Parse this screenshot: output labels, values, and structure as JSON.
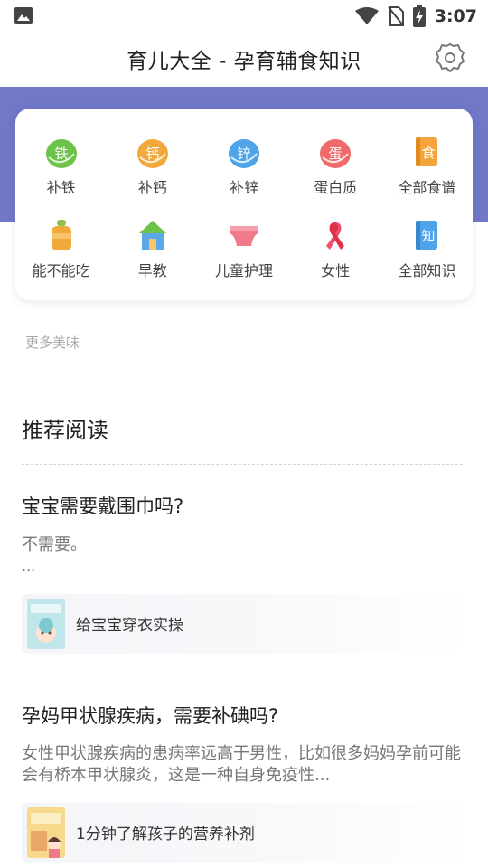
{
  "status_bar": {
    "time": "3:07",
    "icons": [
      "image-icon",
      "wifi-icon",
      "no-sim-icon",
      "battery-charging-icon"
    ]
  },
  "header": {
    "title": "育儿大全 - 孕育辅食知识",
    "settings_icon": "gear-icon"
  },
  "theme": {
    "accent": "#7278c8"
  },
  "categories": [
    {
      "label": "补铁",
      "glyph": "铁",
      "icon": "iron-icon",
      "color": "#6dc24a"
    },
    {
      "label": "补钙",
      "glyph": "钙",
      "icon": "calcium-icon",
      "color": "#f2a93b"
    },
    {
      "label": "补锌",
      "glyph": "锌",
      "icon": "zinc-icon",
      "color": "#4fa3e8"
    },
    {
      "label": "蛋白质",
      "glyph": "蛋",
      "icon": "protein-icon",
      "color": "#f06a6a"
    },
    {
      "label": "全部食谱",
      "glyph": "食",
      "icon": "recipe-book-icon",
      "color": "#f3a43a"
    },
    {
      "label": "能不能吃",
      "glyph": "",
      "icon": "baby-bottle-icon",
      "color": "#f2a93b"
    },
    {
      "label": "早教",
      "glyph": "",
      "icon": "house-icon",
      "color": "#5aa8e8"
    },
    {
      "label": "儿童护理",
      "glyph": "",
      "icon": "diaper-icon",
      "color": "#f07a8a"
    },
    {
      "label": "女性",
      "glyph": "",
      "icon": "ribbon-icon",
      "color": "#f0506a"
    },
    {
      "label": "全部知识",
      "glyph": "知",
      "icon": "knowledge-book-icon",
      "color": "#4fa3e8"
    }
  ],
  "more_label": "更多美味",
  "section_title": "推荐阅读",
  "articles": [
    {
      "title": "宝宝需要戴围巾吗?",
      "excerpt": "不需要。",
      "ellipsis": "...",
      "related": "给宝宝穿衣实操"
    },
    {
      "title": "孕妈甲状腺疾病，需要补碘吗?",
      "excerpt": "女性甲状腺疾病的患病率远高于男性，比如很多妈妈孕前可能会有桥本甲状腺炎，这是一种自身免疫性...",
      "related": "1分钟了解孩子的营养补剂"
    }
  ]
}
